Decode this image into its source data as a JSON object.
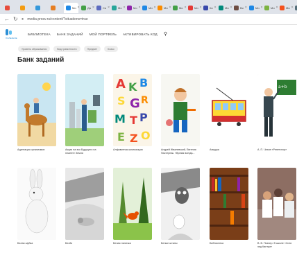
{
  "browser": {
    "tabs": [
      {
        "label": "",
        "color": "#e74c3c"
      },
      {
        "label": "",
        "color": "#f39c12"
      },
      {
        "label": "",
        "color": "#3498db"
      },
      {
        "label": "",
        "color": "#e67e22"
      },
      {
        "label": "Ми",
        "color": "#1e88e5",
        "active": true
      },
      {
        "label": "Да",
        "color": "#43a047"
      },
      {
        "label": "Си",
        "color": "#5c6bc0"
      },
      {
        "label": "Мо",
        "color": "#26a69a"
      },
      {
        "label": "Мо",
        "color": "#8e24aa"
      },
      {
        "label": "Ми",
        "color": "#1e88e5"
      },
      {
        "label": "Ми",
        "color": "#fb8c00"
      },
      {
        "label": "Ми",
        "color": "#43a047"
      },
      {
        "label": "Ми",
        "color": "#e53935"
      },
      {
        "label": "Ки",
        "color": "#3949ab"
      },
      {
        "label": "Ми",
        "color": "#00897b"
      },
      {
        "label": "Ви",
        "color": "#6d4c41"
      },
      {
        "label": "Ми",
        "color": "#1e88e5"
      },
      {
        "label": "Ми",
        "color": "#7cb342"
      },
      {
        "label": "Ми",
        "color": "#f4511e"
      },
      {
        "label": "WEG",
        "color": "#546e7a"
      },
      {
        "label": "Пере",
        "color": "#c62828"
      }
    ],
    "url": "media.prosv.ru/content/?situations=true"
  },
  "site": {
    "logo_sub": "ПОЛЕЗНОЕ",
    "menu": [
      "Библиотека",
      "Банк заданий",
      "Мой портфель",
      "Активировать код"
    ]
  },
  "filters": [
    "Уровень образования",
    "Вид грамотности",
    "Предмет",
    "Класс"
  ],
  "page_title": "Банк заданий",
  "cards": [
    {
      "caption": "Адаптация организмов"
    },
    {
      "caption": "Акция на эко Будущего на планете Земля"
    },
    {
      "caption": "Алфавитная композиция"
    },
    {
      "caption": "Андрей Жвалевский, Евгения Пастернак. «Время всегда..."
    },
    {
      "caption": "Анкудза"
    },
    {
      "caption": "А. П. Чехов «Репетитор»"
    },
    {
      "caption": "Белая шубка"
    },
    {
      "caption": "Белёк"
    },
    {
      "caption": "Белая лиличка"
    },
    {
      "caption": "Белые штаны"
    },
    {
      "caption": "Библиотека"
    },
    {
      "caption": "В. В. Познер. В школе «Сити энд Кантри»"
    }
  ],
  "icons": {
    "back": "back-arrow-icon",
    "reload": "reload-icon",
    "lock": "lock-icon",
    "search": "search-icon",
    "new_tab": "plus-icon"
  }
}
